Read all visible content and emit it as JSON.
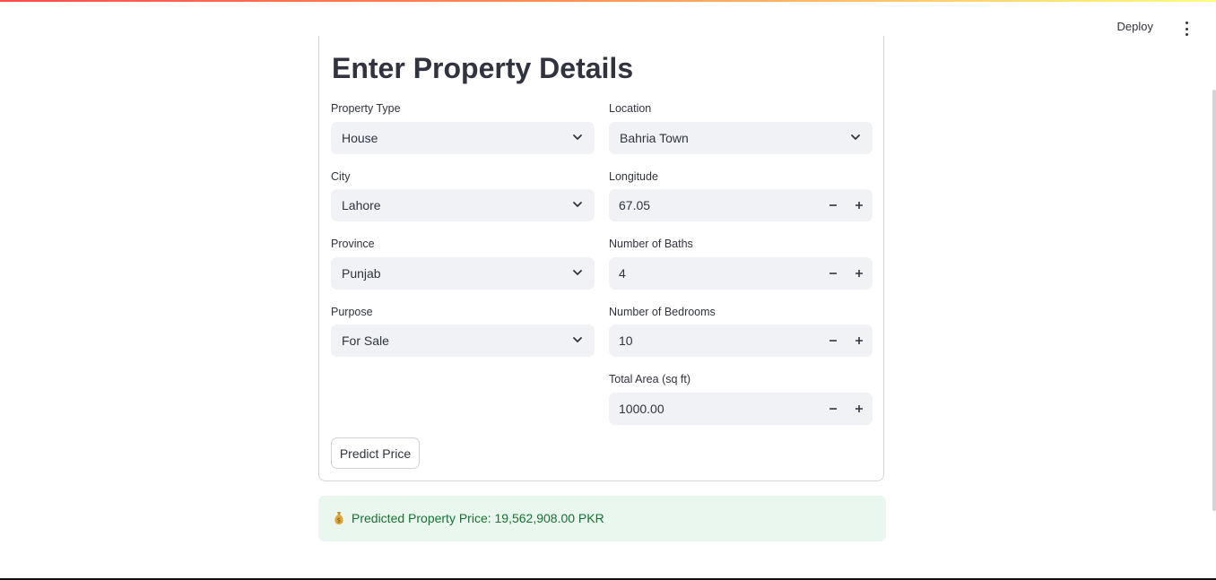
{
  "header": {
    "deploy_label": "Deploy",
    "menu_icon": "more-vertical-icon"
  },
  "form": {
    "title": "Enter Property Details",
    "property_type": {
      "label": "Property Type",
      "value": "House"
    },
    "location": {
      "label": "Location",
      "value": "Bahria Town"
    },
    "city": {
      "label": "City",
      "value": "Lahore"
    },
    "longitude": {
      "label": "Longitude",
      "value": "67.05"
    },
    "province": {
      "label": "Province",
      "value": "Punjab"
    },
    "baths": {
      "label": "Number of Baths",
      "value": "4"
    },
    "purpose": {
      "label": "Purpose",
      "value": "For Sale"
    },
    "bedrooms": {
      "label": "Number of Bedrooms",
      "value": "10"
    },
    "area": {
      "label": "Total Area (sq ft)",
      "value": "1000.00"
    },
    "predict_label": "Predict Price"
  },
  "result": {
    "icon": "money-bag-icon",
    "text": "Predicted Property Price: 19,562,908.00 PKR"
  },
  "colors": {
    "accent_gradient_start": "#ff4b4b",
    "accent_gradient_end": "#fffd80",
    "input_bg": "#f0f2f6",
    "success_bg": "#e9f7ee",
    "success_text": "#177233"
  }
}
